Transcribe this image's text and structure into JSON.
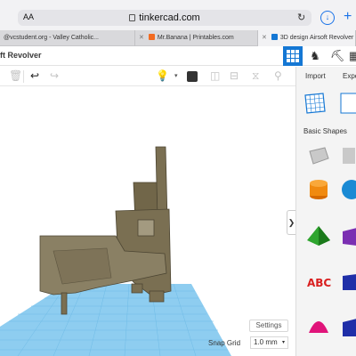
{
  "browser": {
    "aa": "AA",
    "url": "tinkercad.com",
    "tabs": [
      {
        "label": "@vcstudent.org - Valley Catholic..."
      },
      {
        "label": "Mr.Banana | Printables.com"
      },
      {
        "label": "3D design Airsoft Revolver"
      }
    ]
  },
  "app": {
    "design_title": "ft Revolver",
    "view_buttons": [
      "grid-view-icon",
      "blocks-icon",
      "pickaxe-icon",
      "bricks-icon"
    ]
  },
  "panel": {
    "import_label": "Import",
    "export_label": "Expo",
    "category_label": "Basic Shapes"
  },
  "workplane": {
    "settings_label": "Settings",
    "snap_label": "Snap Grid",
    "snap_value": "1.0 mm"
  },
  "colors": {
    "accent": "#1477d4",
    "workplane": "#8ecdf0",
    "gun_body": "#7a6f52",
    "gun_grip": "#8a8064"
  }
}
